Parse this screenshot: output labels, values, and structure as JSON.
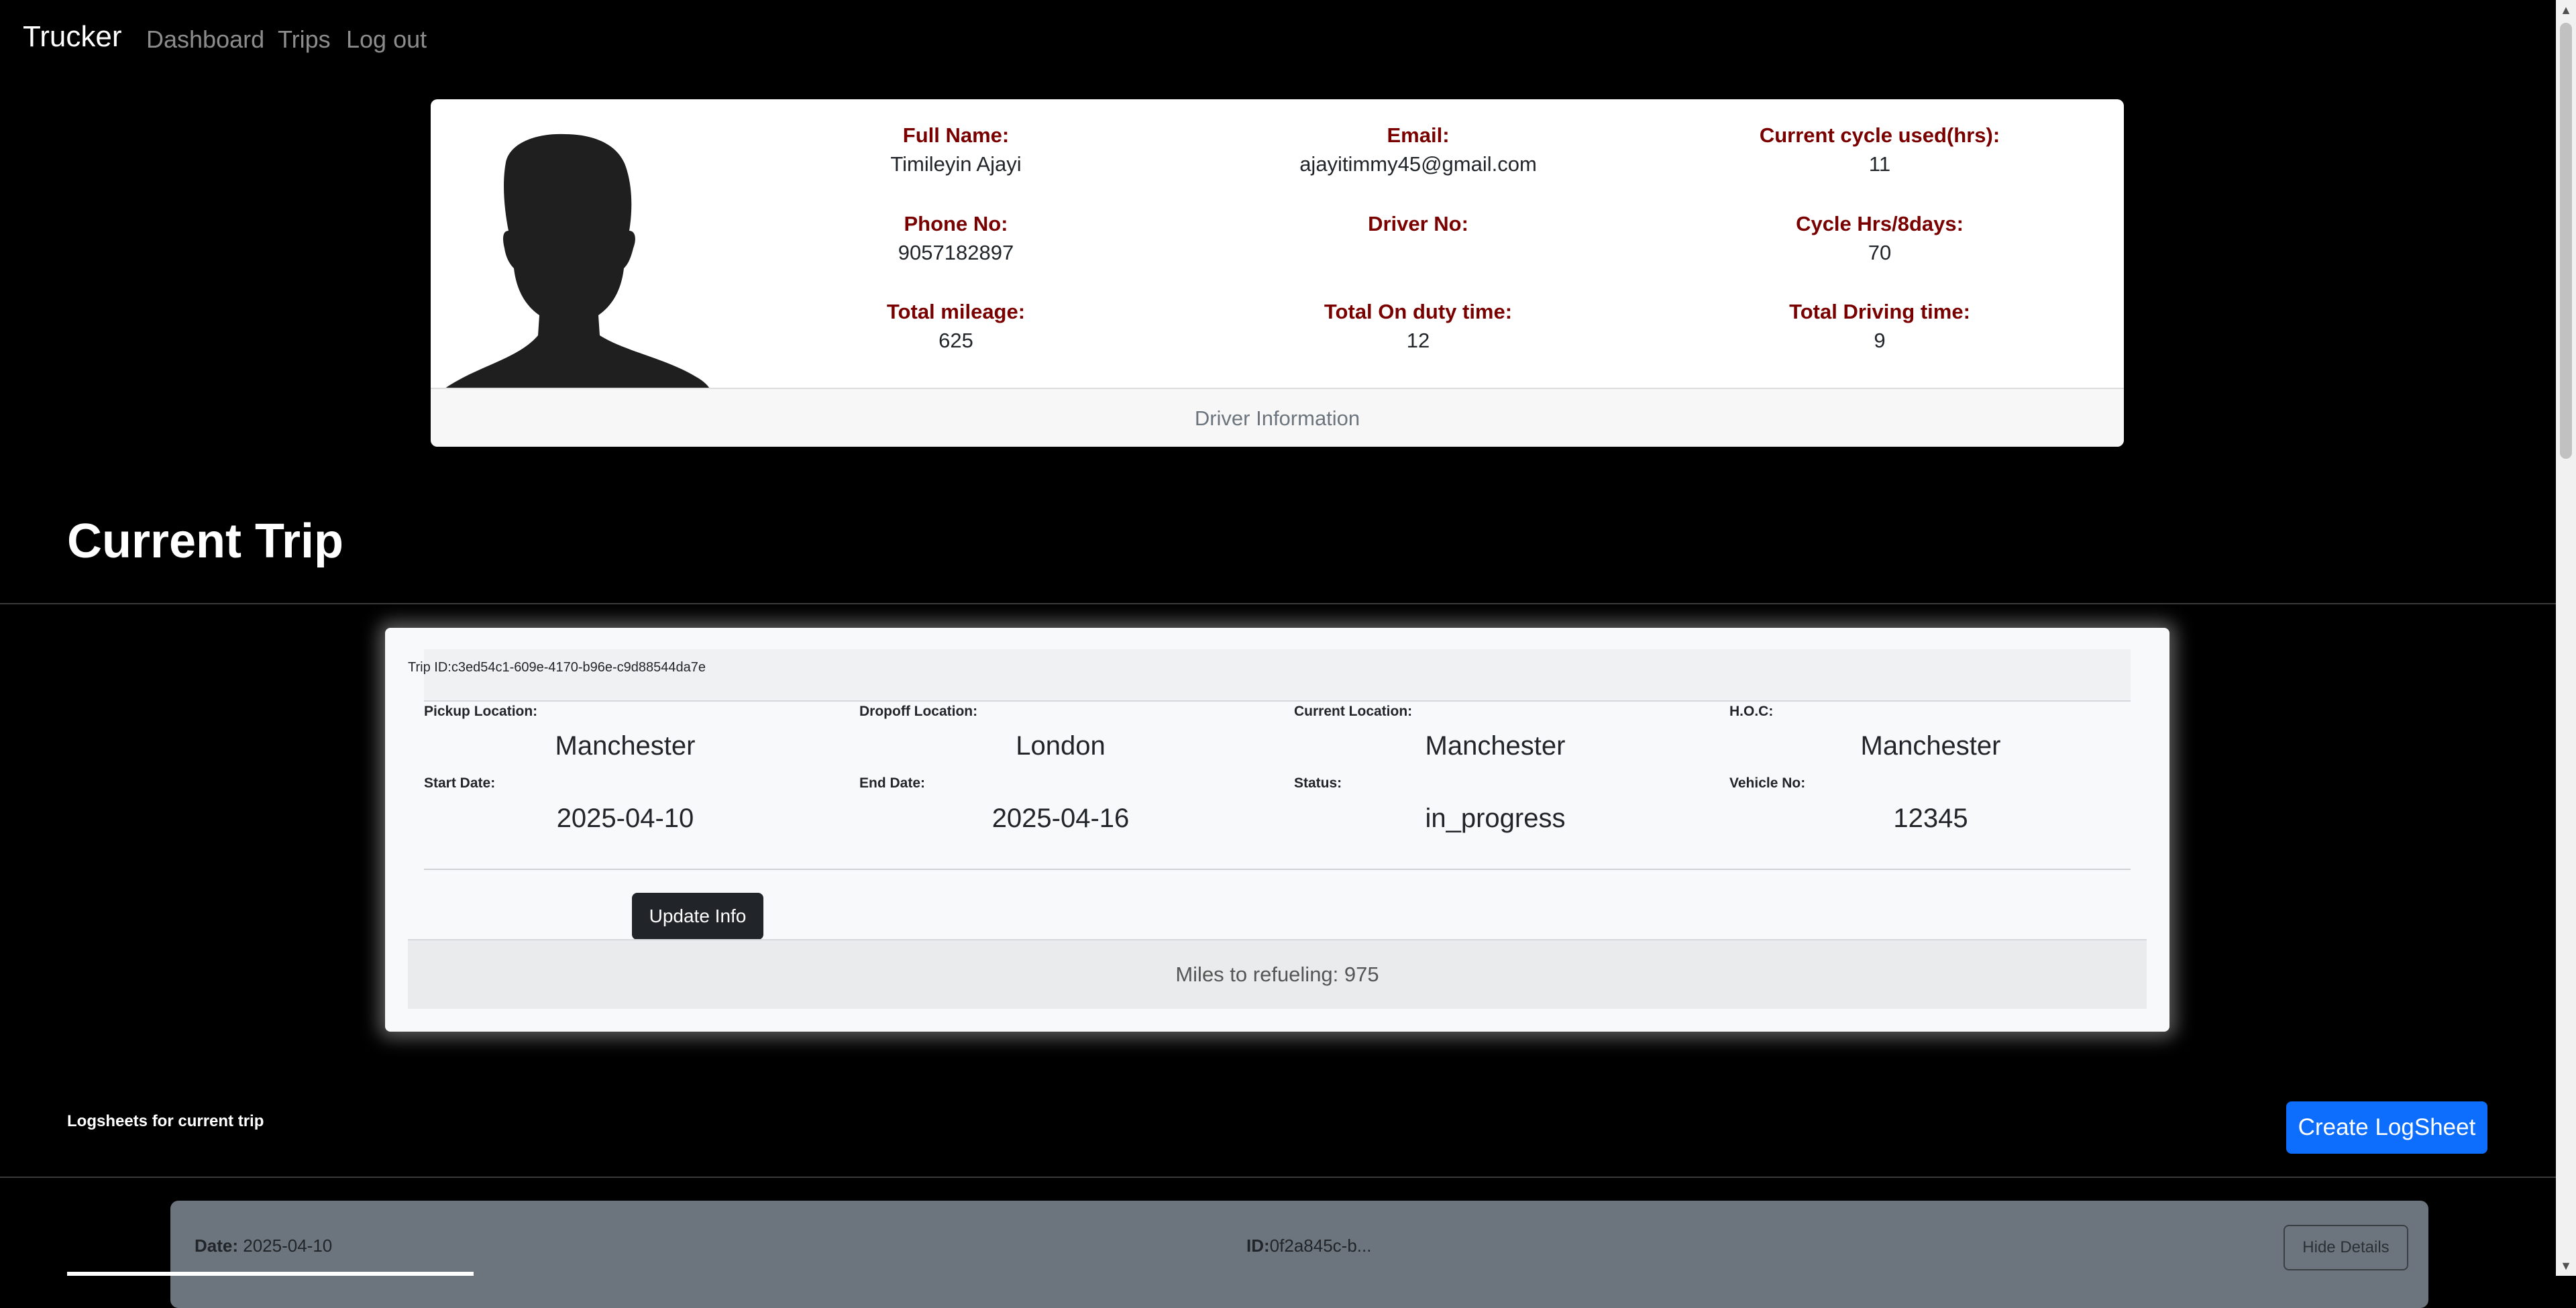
{
  "navbar": {
    "brand": "Trucker",
    "links": [
      "Dashboard",
      "Trips",
      "Log out"
    ]
  },
  "driver": {
    "fields": {
      "full_name": {
        "label": "Full Name:",
        "value": "Timileyin Ajayi"
      },
      "email": {
        "label": "Email:",
        "value": "ajayitimmy45@gmail.com"
      },
      "cycle_used": {
        "label": "Current cycle used(hrs):",
        "value": "11"
      },
      "phone": {
        "label": "Phone No:",
        "value": "9057182897"
      },
      "driver_no": {
        "label": "Driver No:",
        "value": ""
      },
      "cycle_hrs": {
        "label": "Cycle Hrs/8days:",
        "value": "70"
      },
      "total_mileage": {
        "label": "Total mileage:",
        "value": "625"
      },
      "on_duty": {
        "label": "Total On duty time:",
        "value": "12"
      },
      "driving_time": {
        "label": "Total Driving time:",
        "value": "9"
      }
    },
    "footer": "Driver Information",
    "avatar_icon": "user-silhouette-icon"
  },
  "page_title": "Current Trip",
  "trip": {
    "id_label": "Trip ID:",
    "id_value": "c3ed54c1-609e-4170-b96e-c9d88544da7e",
    "pickup": {
      "label": "Pickup Location:",
      "value": "Manchester"
    },
    "dropoff": {
      "label": "Dropoff Location:",
      "value": "London"
    },
    "current": {
      "label": "Current Location:",
      "value": "Manchester"
    },
    "hoc": {
      "label": "H.O.C:",
      "value": "Manchester"
    },
    "start": {
      "label": "Start Date:",
      "value": "2025-04-10"
    },
    "end": {
      "label": "End Date:",
      "value": "2025-04-16"
    },
    "status": {
      "label": "Status:",
      "value": "in_progress"
    },
    "vehicle": {
      "label": "Vehicle No:",
      "value": "12345"
    },
    "update_button": "Update Info",
    "refuel_label": "Miles to refueling: ",
    "refuel_value": "975"
  },
  "logs": {
    "title": "Logsheets for current trip",
    "create_button": "Create LogSheet",
    "items": [
      {
        "date_label": "Date:",
        "date_value": "2025-04-10",
        "id_label": "ID:",
        "id_value": "0f2a845c-b...",
        "hide_button": "Hide Details"
      }
    ]
  },
  "colors": {
    "background": "#000000",
    "label_red": "#7a0000",
    "primary": "#0d6efd",
    "dark_button": "#212529",
    "log_card": "#6c757d"
  }
}
